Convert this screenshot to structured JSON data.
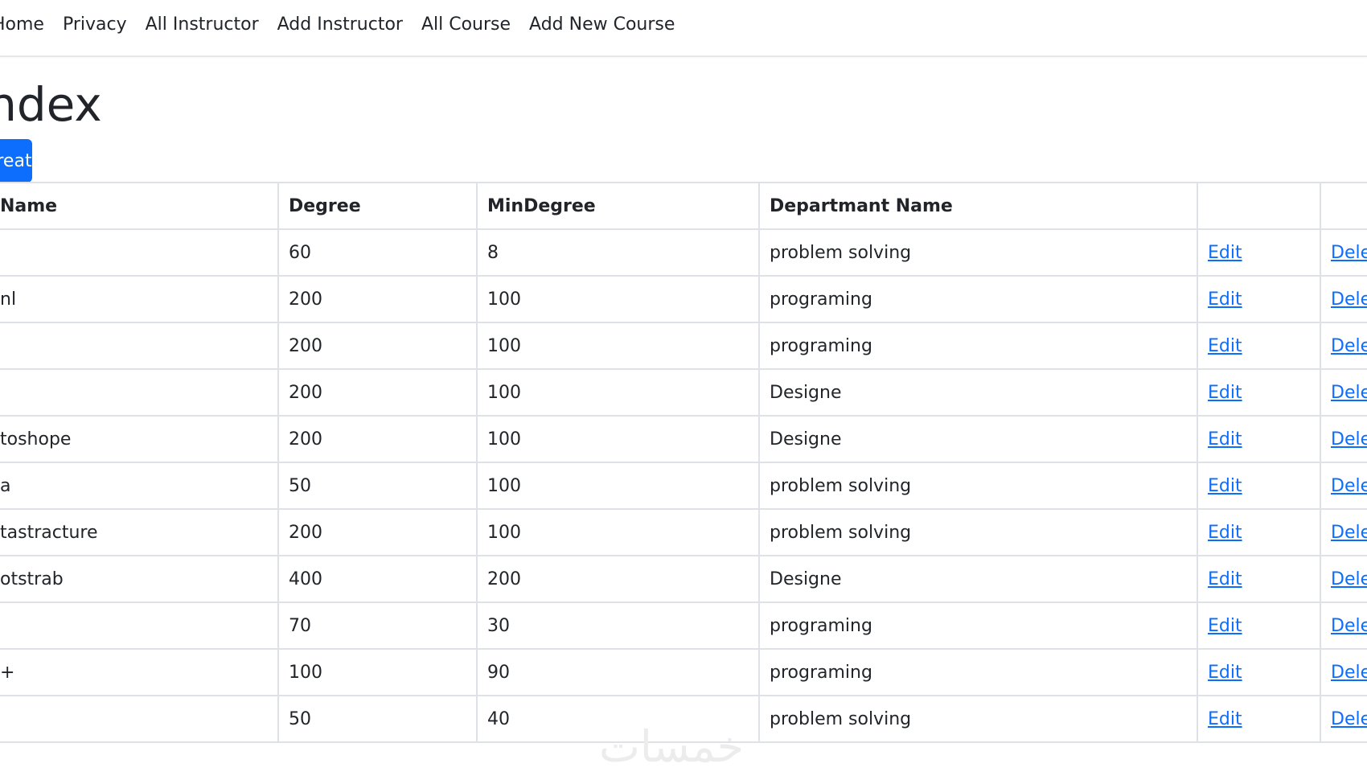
{
  "nav": {
    "items": [
      "Home",
      "Privacy",
      "All Instructor",
      "Add Instructor",
      "All Course",
      "Add New Course"
    ]
  },
  "page": {
    "title": "Index",
    "create_label": "Create New"
  },
  "table": {
    "headers": {
      "name": "Name",
      "degree": "Degree",
      "min_degree": "MinDegree",
      "department": "Departmant Name"
    },
    "edit_label": "Edit",
    "delete_label": "Delete",
    "rows": [
      {
        "name": "",
        "degree": "60",
        "min_degree": "8",
        "department": "problem solving"
      },
      {
        "name": "nl",
        "degree": "200",
        "min_degree": "100",
        "department": "programing"
      },
      {
        "name": "",
        "degree": "200",
        "min_degree": "100",
        "department": "programing"
      },
      {
        "name": "",
        "degree": "200",
        "min_degree": "100",
        "department": "Designe"
      },
      {
        "name": "toshope",
        "degree": "200",
        "min_degree": "100",
        "department": "Designe"
      },
      {
        "name": "a",
        "degree": "50",
        "min_degree": "100",
        "department": "problem solving"
      },
      {
        "name": "tastracture",
        "degree": "200",
        "min_degree": "100",
        "department": "problem solving"
      },
      {
        "name": "otstrab",
        "degree": "400",
        "min_degree": "200",
        "department": "Designe"
      },
      {
        "name": "",
        "degree": "70",
        "min_degree": "30",
        "department": "programing"
      },
      {
        "name": "+",
        "degree": "100",
        "min_degree": "90",
        "department": "programing"
      },
      {
        "name": "",
        "degree": "50",
        "min_degree": "40",
        "department": "problem solving"
      }
    ]
  },
  "watermark": "خمسات",
  "colors": {
    "link": "#0d6efd",
    "primary_button": "#0d6efd",
    "border": "#dee2e6",
    "text": "#212529"
  }
}
